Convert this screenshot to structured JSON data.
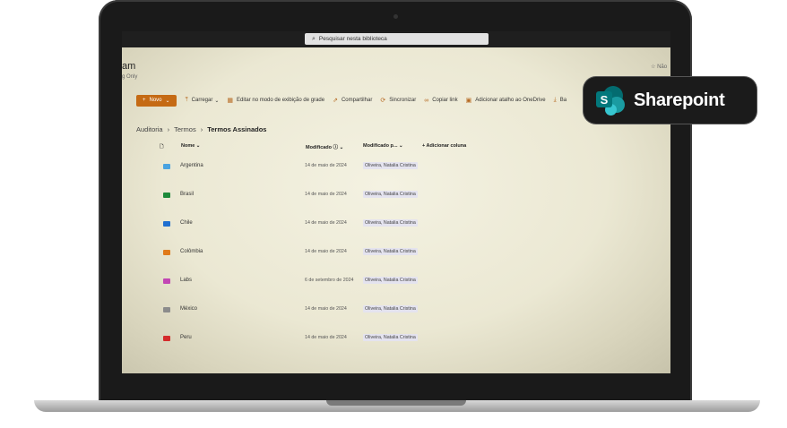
{
  "search": {
    "placeholder": "Pesquisar nesta biblioteca"
  },
  "site": {
    "title": "am",
    "subtitle": "g Only",
    "follow": "Não"
  },
  "commandbar": {
    "new_label": "Novo",
    "items": [
      {
        "label": "Carregar",
        "icon": "upload-icon"
      },
      {
        "label": "Editar no modo de exibição de grade",
        "icon": "grid-icon"
      },
      {
        "label": "Compartilhar",
        "icon": "share-icon"
      },
      {
        "label": "Sincronizar",
        "icon": "sync-icon"
      },
      {
        "label": "Copiar link",
        "icon": "link-icon"
      },
      {
        "label": "Adicionar atalho ao OneDrive",
        "icon": "shortcut-icon"
      },
      {
        "label": "Ba",
        "icon": "download-icon"
      }
    ]
  },
  "breadcrumb": {
    "items": [
      "Auditoria",
      "Termos",
      "Termos Assinados"
    ]
  },
  "columns": {
    "name": "Nome",
    "modified": "Modificado",
    "modified_by": "Modificado p...",
    "add_column": "Adicionar coluna"
  },
  "rows": [
    {
      "name": "Argentina",
      "date": "14 de maio de 2024",
      "by": "Oliveira, Natalia Cristina",
      "color": "#4aa3e0"
    },
    {
      "name": "Brasil",
      "date": "14 de maio de 2024",
      "by": "Oliveira, Natalia Cristina",
      "color": "#1e8a3a"
    },
    {
      "name": "Chile",
      "date": "14 de maio de 2024",
      "by": "Oliveira, Natalia Cristina",
      "color": "#1f6fd0"
    },
    {
      "name": "Colômbia",
      "date": "14 de maio de 2024",
      "by": "Oliveira, Natalia Cristina",
      "color": "#e07a1a"
    },
    {
      "name": "Labs",
      "date": "6 de setembro de 2024",
      "by": "Oliveira, Natalia Cristina",
      "color": "#c246b4"
    },
    {
      "name": "México",
      "date": "14 de maio de 2024",
      "by": "Oliveira, Natalia Cristina",
      "color": "#8c8c8c"
    },
    {
      "name": "Peru",
      "date": "14 de maio de 2024",
      "by": "Oliveira, Natalia Cristina",
      "color": "#d42b2b"
    }
  ],
  "badge": {
    "text": "Sharepoint",
    "logo_letter": "S"
  }
}
